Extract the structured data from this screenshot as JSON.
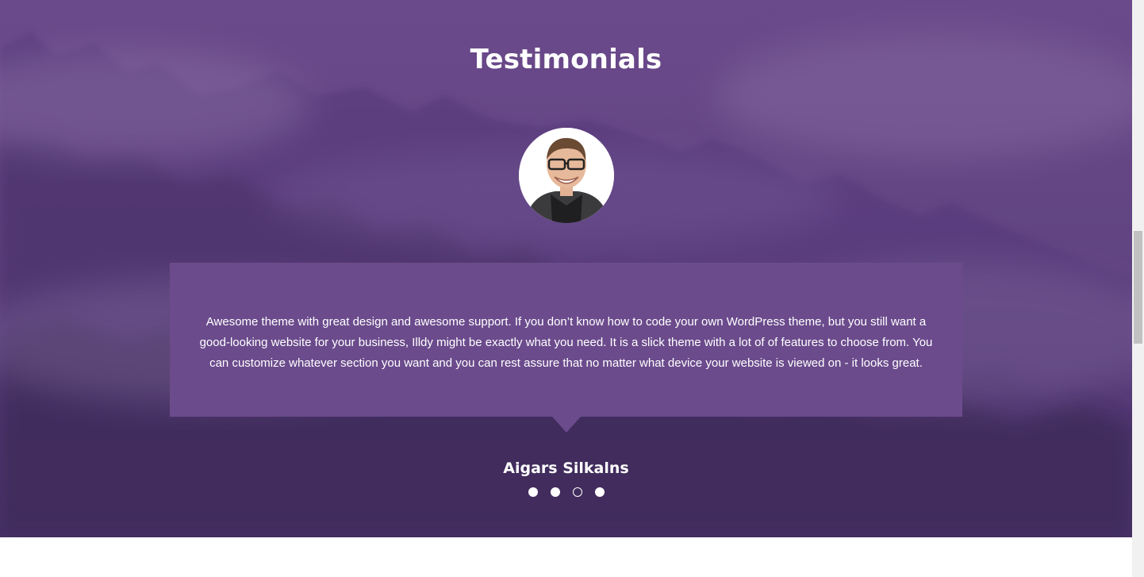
{
  "testimonials": {
    "title": "Testimonials",
    "quote": "Awesome theme with great design and awesome support. If you don’t know how to code your own WordPress theme, but you still want a good-looking website for your business, Illdy might be exactly what you need. It is a slick theme with a lot of of features to choose from. You can customize whatever section you want and you can rest assure that no matter what device your website is viewed on - it looks great.",
    "author": "Aigars Silkalns",
    "slides": 4,
    "active_slide": 3
  },
  "icons": {
    "avatar": "person-avatar-photo",
    "background": "misty-forest-image"
  },
  "colors": {
    "section_overlay": "#6a4a8a",
    "quote_box": "#6b4b8c",
    "text": "#ffffff",
    "page_background": "#ffffff"
  }
}
